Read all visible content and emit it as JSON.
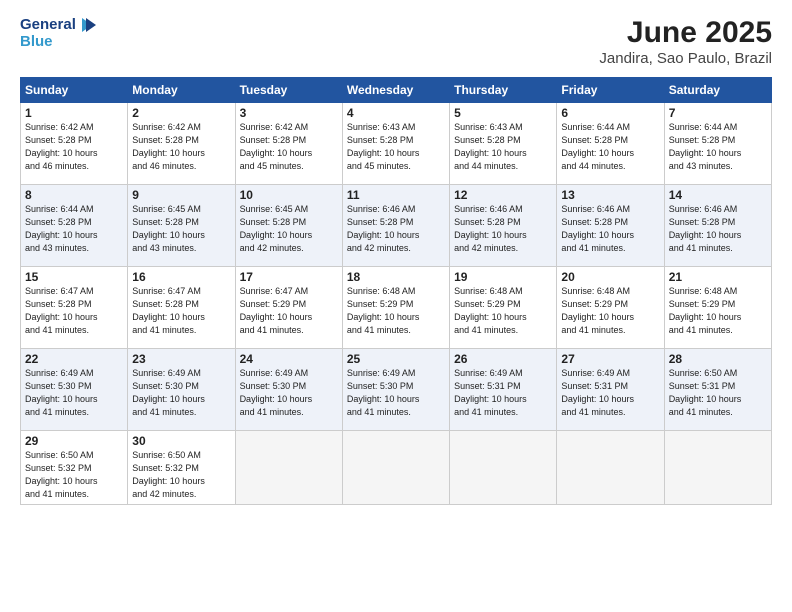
{
  "header": {
    "logo_line1": "General",
    "logo_line2": "Blue",
    "title": "June 2025",
    "subtitle": "Jandira, Sao Paulo, Brazil"
  },
  "days_of_week": [
    "Sunday",
    "Monday",
    "Tuesday",
    "Wednesday",
    "Thursday",
    "Friday",
    "Saturday"
  ],
  "weeks": [
    [
      {
        "day": "1",
        "info": "Sunrise: 6:42 AM\nSunset: 5:28 PM\nDaylight: 10 hours\nand 46 minutes."
      },
      {
        "day": "2",
        "info": "Sunrise: 6:42 AM\nSunset: 5:28 PM\nDaylight: 10 hours\nand 46 minutes."
      },
      {
        "day": "3",
        "info": "Sunrise: 6:42 AM\nSunset: 5:28 PM\nDaylight: 10 hours\nand 45 minutes."
      },
      {
        "day": "4",
        "info": "Sunrise: 6:43 AM\nSunset: 5:28 PM\nDaylight: 10 hours\nand 45 minutes."
      },
      {
        "day": "5",
        "info": "Sunrise: 6:43 AM\nSunset: 5:28 PM\nDaylight: 10 hours\nand 44 minutes."
      },
      {
        "day": "6",
        "info": "Sunrise: 6:44 AM\nSunset: 5:28 PM\nDaylight: 10 hours\nand 44 minutes."
      },
      {
        "day": "7",
        "info": "Sunrise: 6:44 AM\nSunset: 5:28 PM\nDaylight: 10 hours\nand 43 minutes."
      }
    ],
    [
      {
        "day": "8",
        "info": "Sunrise: 6:44 AM\nSunset: 5:28 PM\nDaylight: 10 hours\nand 43 minutes."
      },
      {
        "day": "9",
        "info": "Sunrise: 6:45 AM\nSunset: 5:28 PM\nDaylight: 10 hours\nand 43 minutes."
      },
      {
        "day": "10",
        "info": "Sunrise: 6:45 AM\nSunset: 5:28 PM\nDaylight: 10 hours\nand 42 minutes."
      },
      {
        "day": "11",
        "info": "Sunrise: 6:46 AM\nSunset: 5:28 PM\nDaylight: 10 hours\nand 42 minutes."
      },
      {
        "day": "12",
        "info": "Sunrise: 6:46 AM\nSunset: 5:28 PM\nDaylight: 10 hours\nand 42 minutes."
      },
      {
        "day": "13",
        "info": "Sunrise: 6:46 AM\nSunset: 5:28 PM\nDaylight: 10 hours\nand 41 minutes."
      },
      {
        "day": "14",
        "info": "Sunrise: 6:46 AM\nSunset: 5:28 PM\nDaylight: 10 hours\nand 41 minutes."
      }
    ],
    [
      {
        "day": "15",
        "info": "Sunrise: 6:47 AM\nSunset: 5:28 PM\nDaylight: 10 hours\nand 41 minutes."
      },
      {
        "day": "16",
        "info": "Sunrise: 6:47 AM\nSunset: 5:28 PM\nDaylight: 10 hours\nand 41 minutes."
      },
      {
        "day": "17",
        "info": "Sunrise: 6:47 AM\nSunset: 5:29 PM\nDaylight: 10 hours\nand 41 minutes."
      },
      {
        "day": "18",
        "info": "Sunrise: 6:48 AM\nSunset: 5:29 PM\nDaylight: 10 hours\nand 41 minutes."
      },
      {
        "day": "19",
        "info": "Sunrise: 6:48 AM\nSunset: 5:29 PM\nDaylight: 10 hours\nand 41 minutes."
      },
      {
        "day": "20",
        "info": "Sunrise: 6:48 AM\nSunset: 5:29 PM\nDaylight: 10 hours\nand 41 minutes."
      },
      {
        "day": "21",
        "info": "Sunrise: 6:48 AM\nSunset: 5:29 PM\nDaylight: 10 hours\nand 41 minutes."
      }
    ],
    [
      {
        "day": "22",
        "info": "Sunrise: 6:49 AM\nSunset: 5:30 PM\nDaylight: 10 hours\nand 41 minutes."
      },
      {
        "day": "23",
        "info": "Sunrise: 6:49 AM\nSunset: 5:30 PM\nDaylight: 10 hours\nand 41 minutes."
      },
      {
        "day": "24",
        "info": "Sunrise: 6:49 AM\nSunset: 5:30 PM\nDaylight: 10 hours\nand 41 minutes."
      },
      {
        "day": "25",
        "info": "Sunrise: 6:49 AM\nSunset: 5:30 PM\nDaylight: 10 hours\nand 41 minutes."
      },
      {
        "day": "26",
        "info": "Sunrise: 6:49 AM\nSunset: 5:31 PM\nDaylight: 10 hours\nand 41 minutes."
      },
      {
        "day": "27",
        "info": "Sunrise: 6:49 AM\nSunset: 5:31 PM\nDaylight: 10 hours\nand 41 minutes."
      },
      {
        "day": "28",
        "info": "Sunrise: 6:50 AM\nSunset: 5:31 PM\nDaylight: 10 hours\nand 41 minutes."
      }
    ],
    [
      {
        "day": "29",
        "info": "Sunrise: 6:50 AM\nSunset: 5:32 PM\nDaylight: 10 hours\nand 41 minutes."
      },
      {
        "day": "30",
        "info": "Sunrise: 6:50 AM\nSunset: 5:32 PM\nDaylight: 10 hours\nand 42 minutes."
      },
      {
        "day": "",
        "info": ""
      },
      {
        "day": "",
        "info": ""
      },
      {
        "day": "",
        "info": ""
      },
      {
        "day": "",
        "info": ""
      },
      {
        "day": "",
        "info": ""
      }
    ]
  ]
}
